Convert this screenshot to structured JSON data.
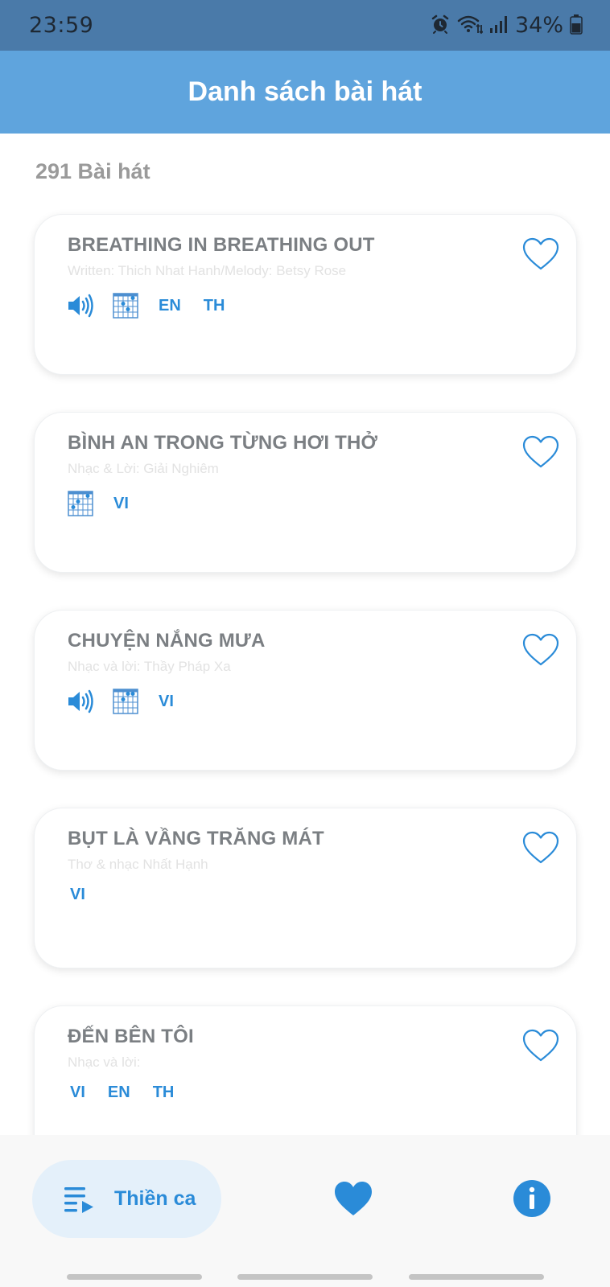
{
  "status_bar": {
    "time": "23:59",
    "battery": "34%",
    "icons": [
      "alarm-icon",
      "wifi-icon",
      "signal-icon",
      "battery-icon"
    ]
  },
  "header": {
    "title": "Danh sách bài hát"
  },
  "song_count": "291 Bài hát",
  "songs": [
    {
      "title": "BREATHING IN BREATHING OUT",
      "author": "Written: Thich Nhat Hanh/Melody: Betsy Rose",
      "has_audio": true,
      "has_chords": true,
      "languages": [
        "EN",
        "TH"
      ]
    },
    {
      "title": "BÌNH AN TRONG TỪNG HƠI THỞ",
      "author": "Nhạc & Lời: Giải Nghiêm",
      "has_audio": false,
      "has_chords": true,
      "languages": [
        "VI"
      ]
    },
    {
      "title": "CHUYỆN NẮNG MƯA",
      "author": "Nhạc và lời: Thầy Pháp Xa",
      "has_audio": true,
      "has_chords": true,
      "languages": [
        "VI"
      ]
    },
    {
      "title": "BỤT LÀ VẦNG TRĂNG MÁT",
      "author": "Thơ & nhạc Nhất Hạnh",
      "has_audio": false,
      "has_chords": false,
      "languages": [
        "VI"
      ]
    },
    {
      "title": "ĐẾN BÊN TÔI",
      "author": "Nhạc và lời:",
      "has_audio": false,
      "has_chords": false,
      "languages": [
        "VI",
        "EN",
        "TH"
      ]
    }
  ],
  "bottom_nav": {
    "active_label": "Thiền ca",
    "items": [
      "playlist-icon",
      "heart-icon",
      "info-icon"
    ]
  },
  "colors": {
    "status_bar": "#4a7aa9",
    "header": "#5fa4dd",
    "accent": "#2a8bd8",
    "title_text": "#7b7f83",
    "author_text": "#e2e2e2",
    "nav_pill": "#e4f0fa"
  }
}
